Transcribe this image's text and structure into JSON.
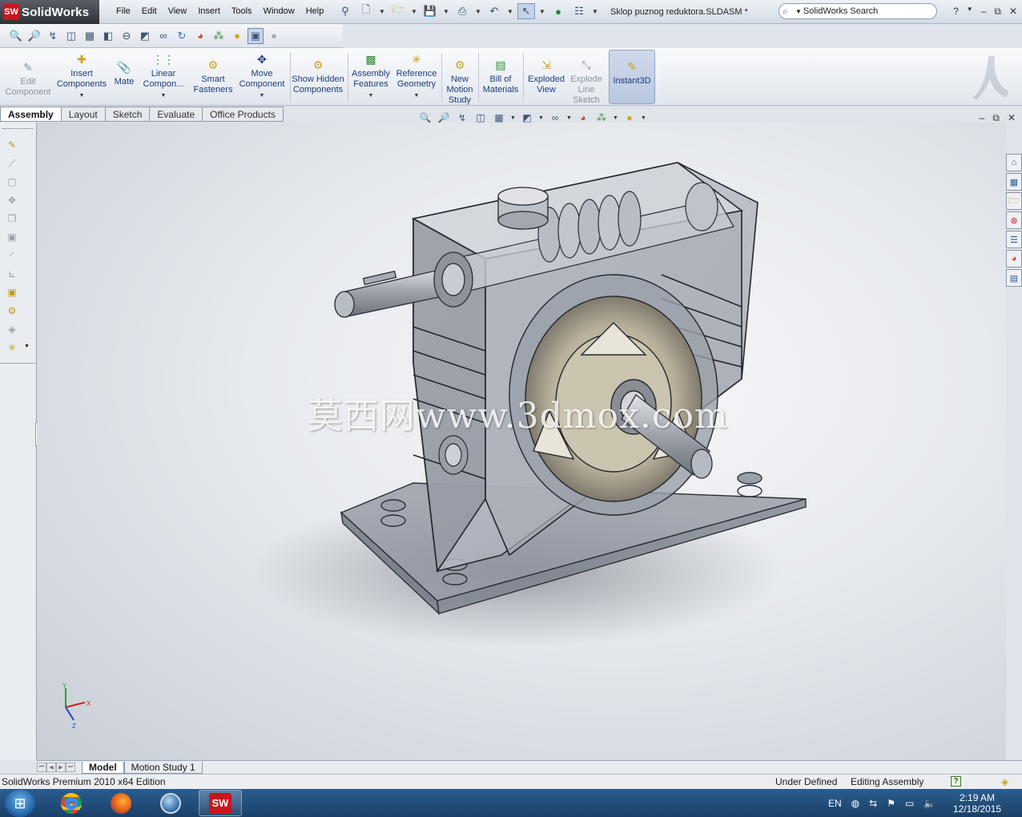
{
  "app": {
    "logo_mark": "SW",
    "logo_text": "SolidWorks",
    "document_title": "Sklop puznog reduktora.SLDASM *"
  },
  "menus": [
    "File",
    "Edit",
    "View",
    "Insert",
    "Tools",
    "Window",
    "Help"
  ],
  "search": {
    "placeholder": "SolidWorks Search"
  },
  "command_manager": {
    "edit_component": "Edit Component",
    "insert_components": "Insert Components",
    "mate": "Mate",
    "linear_component": "Linear Compon...",
    "smart_fasteners": "Smart Fasteners",
    "move_component": "Move Component",
    "show_hidden": "Show Hidden Components",
    "assembly_features": "Assembly Features",
    "reference_geometry": "Reference Geometry",
    "new_motion_study": "New Motion Study",
    "bill_of_materials": "Bill of Materials",
    "exploded_view": "Exploded View",
    "explode_line_sketch": "Explode Line Sketch",
    "instant3d": "Instant3D"
  },
  "tabs": [
    "Assembly",
    "Layout",
    "Sketch",
    "Evaluate",
    "Office Products"
  ],
  "watermark": "莫西网www.3dmox.com",
  "triad": {
    "x": "X",
    "y": "Y",
    "z": "Z"
  },
  "bottom_tabs": [
    "Model",
    "Motion Study 1"
  ],
  "status": {
    "edition": "SolidWorks Premium 2010 x64 Edition",
    "definition": "Under Defined",
    "mode": "Editing Assembly",
    "help_icon": "?"
  },
  "taskbar": {
    "language": "EN",
    "time": "2:19 AM",
    "date": "12/18/2015",
    "sw_label": "SW"
  },
  "colors": {
    "brand_red": "#c8161d",
    "command_text": "#1c3c78",
    "viewport_bg": "#e6e9ee",
    "taskbar": "#1b4067"
  }
}
